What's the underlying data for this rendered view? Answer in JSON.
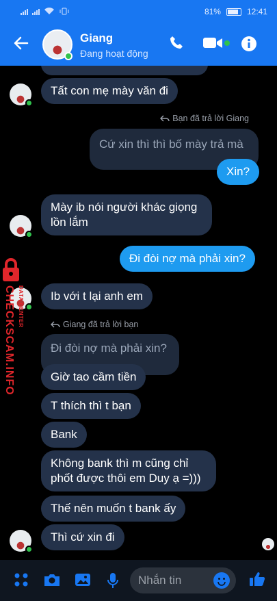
{
  "status_bar": {
    "battery": "81%",
    "time": "12:41"
  },
  "header": {
    "name": "Giang",
    "status": "Đang hoạt động"
  },
  "messages": {
    "m0": "Tất con mẹ mày văn đi",
    "reply1": "Bạn đã trả lời Giang",
    "q1": "Cứ xin thì thì bố mày trả mà",
    "m1": "Xin?",
    "m2": "Mày ib nói người khác giọng lồn lắm",
    "m3": "Đi đòi nợ mà phải xin?",
    "m4": "Ib với t lại anh em",
    "reply2": "Giang đã trả lời bạn",
    "q2": "Đi đòi nợ mà phải xin?",
    "m5": "Giờ tao cầm tiền",
    "m6": "T thích thì t bạn",
    "m7": "Bank",
    "m8": "Không bank thì m cũng chỉ phốt được thôi em Duy ạ =)))",
    "m9": "Thế nên muốn t bank ấy",
    "m10": "Thì cứ xin đi"
  },
  "watermark": {
    "main": "CHECKSCAM.INFO",
    "sub": "DATA CENTER"
  },
  "composer": {
    "placeholder": "Nhắn tin"
  },
  "colors": {
    "brand": "#1877f2",
    "outgoing": "#1e9bf0",
    "incoming": "#24324a",
    "watermark": "#e0262b"
  }
}
